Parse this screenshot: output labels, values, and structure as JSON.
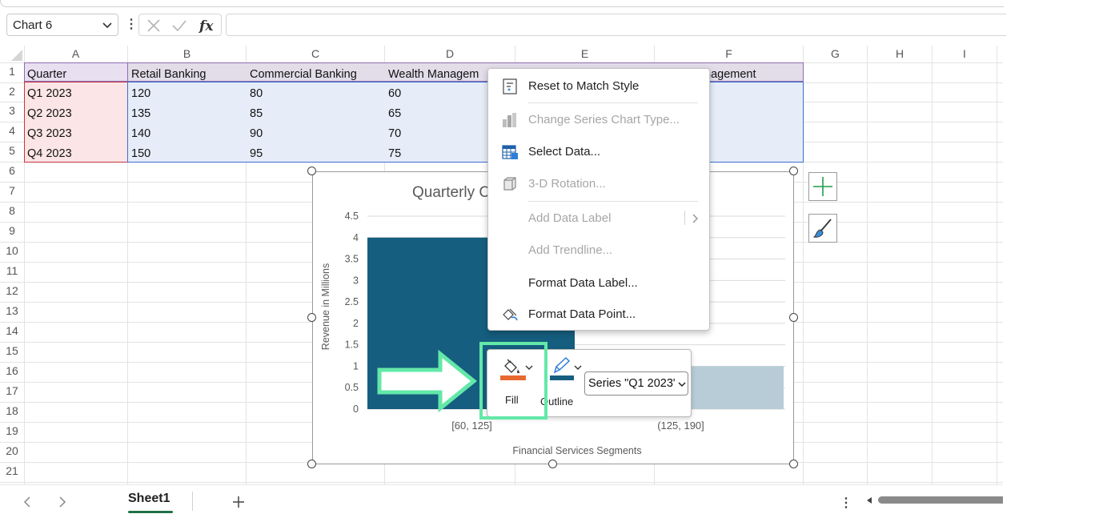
{
  "formula_bar": {
    "name_box": "Chart 6",
    "formula": ""
  },
  "columns": [
    "A",
    "B",
    "C",
    "D",
    "E",
    "F",
    "G",
    "H",
    "I"
  ],
  "rows": [
    "1",
    "2",
    "3",
    "4",
    "5",
    "6",
    "7",
    "8",
    "9",
    "10",
    "11",
    "12",
    "13",
    "14",
    "15",
    "16",
    "17",
    "18",
    "19",
    "20",
    "21"
  ],
  "table": {
    "headers": [
      "Quarter",
      "Retail Banking",
      "Commercial Banking",
      "Wealth Managem"
    ],
    "f1_partial": "nagement",
    "data": [
      [
        "Q1 2023",
        "120",
        "80",
        "60"
      ],
      [
        "Q2 2023",
        "135",
        "85",
        "65"
      ],
      [
        "Q3 2023",
        "140",
        "90",
        "70"
      ],
      [
        "Q4 2023",
        "150",
        "95",
        "75"
      ]
    ]
  },
  "chart_data": {
    "type": "bar",
    "title": "Quarterly C",
    "xlabel": "Financial Services Segments",
    "ylabel": "Revenue in Millions",
    "ylim": [
      0,
      4.5
    ],
    "ytick_labels": [
      "4.5",
      "4",
      "3.5",
      "3",
      "2.5",
      "2",
      "1.5",
      "1",
      "0.5",
      "0"
    ],
    "categories": [
      "[60, 125]",
      "(125, 190]"
    ],
    "values": [
      4,
      1
    ],
    "grid": true,
    "colors": {
      "bar1": "#155e7f",
      "bar2": "#b7ccd6"
    }
  },
  "context_menu": {
    "items": [
      {
        "label": "Reset to Match Style",
        "enabled": true,
        "icon": "reset-style-icon"
      },
      {
        "label": "Change Series Chart Type...",
        "enabled": false,
        "icon": "chart-type-icon"
      },
      {
        "label": "Select Data...",
        "enabled": true,
        "icon": "select-data-icon"
      },
      {
        "label": "3-D Rotation...",
        "enabled": false,
        "icon": "rotation-3d-icon"
      },
      {
        "label": "Add Data Label",
        "enabled": false,
        "icon": ""
      },
      {
        "label": "Add Trendline...",
        "enabled": false,
        "icon": ""
      },
      {
        "label": "Format Data Label...",
        "enabled": true,
        "icon": ""
      },
      {
        "label": "Format Data Point...",
        "enabled": true,
        "icon": "format-data-point-icon"
      }
    ]
  },
  "mini_toolbar": {
    "fill_label": "Fill",
    "outline_label": "Outline",
    "series_value": "Series \"Q1 2023\"",
    "fill_color": "#e8692f",
    "outline_color": "#155e7f"
  },
  "sheet_tabs": {
    "active": "Sheet1"
  },
  "accent": {
    "highlight": "#63e8a8",
    "excel_green": "#1e7145"
  }
}
